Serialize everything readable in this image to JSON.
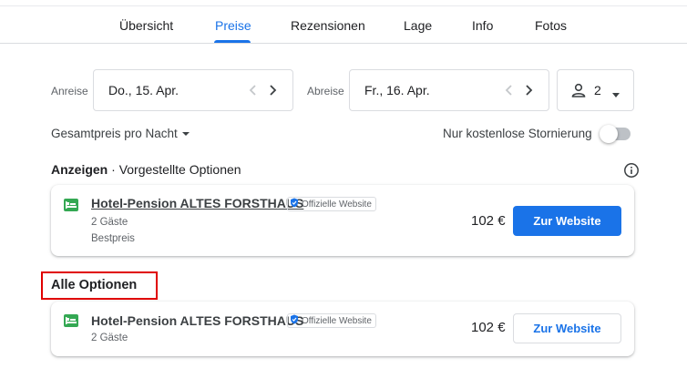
{
  "nav": {
    "tabs": [
      {
        "label": "Übersicht",
        "active": false
      },
      {
        "label": "Preise",
        "active": true
      },
      {
        "label": "Rezensionen",
        "active": false
      },
      {
        "label": "Lage",
        "active": false
      },
      {
        "label": "Info",
        "active": false
      },
      {
        "label": "Fotos",
        "active": false
      }
    ]
  },
  "search": {
    "checkin_label": "Anreise",
    "checkin_value": "Do., 15. Apr.",
    "checkout_label": "Abreise",
    "checkout_value": "Fr., 16. Apr.",
    "guests": "2"
  },
  "filters": {
    "price_mode": "Gesamtpreis pro Nacht",
    "free_cancellation_label": "Nur kostenlose Stornierung",
    "free_cancellation_on": false
  },
  "featured": {
    "ads_label": "Anzeigen",
    "separator": "·",
    "title": "Vorgestellte Optionen",
    "offer": {
      "hotel_name": "Hotel-Pension ALTES FORSTHAUS",
      "badge": "Offizielle Website",
      "guests": "2 Gäste",
      "tag": "Bestpreis",
      "price": "102 €",
      "button": "Zur Website"
    }
  },
  "all_options": {
    "title": "Alle Optionen",
    "offer": {
      "hotel_name": "Hotel-Pension ALTES FORSTHAUS",
      "badge": "Offizielle Website",
      "guests": "2 Gäste",
      "price": "102 €",
      "button": "Zur Website"
    }
  },
  "colors": {
    "accent": "#1a73e8",
    "hotel_icon": "#34a853",
    "highlight_border": "#e00000"
  }
}
